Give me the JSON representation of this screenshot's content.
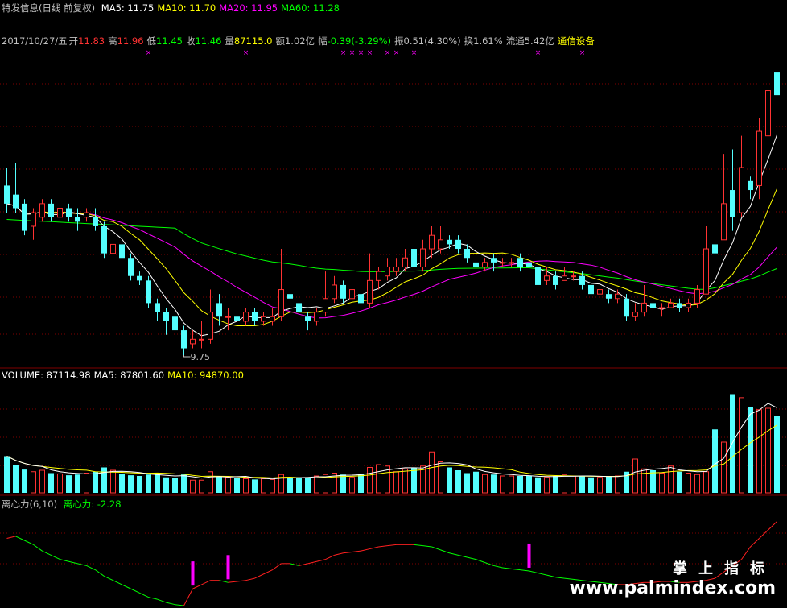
{
  "header": {
    "stock_name": "特发信息(日线 前复权)",
    "ma_items": [
      {
        "label": "MA5: 11.75",
        "color": "#ffffff"
      },
      {
        "label": "MA10: 11.70",
        "color": "#ffff00"
      },
      {
        "label": "MA20: 11.95",
        "color": "#ff00ff"
      },
      {
        "label": "MA60: 11.28",
        "color": "#00ff00"
      }
    ]
  },
  "quote": {
    "date": "2017/10/27/五",
    "open_label": "开",
    "open": "11.83",
    "high_label": "高",
    "high": "11.96",
    "low_label": "低",
    "low": "11.45",
    "close_label": "收",
    "close": "11.46",
    "vol_label": "量",
    "vol": "87115.0",
    "amt_label": "额",
    "amt": "1.02亿",
    "chg_label": "幅",
    "chg": "-0.39(-3.29%)",
    "amp_label": "振",
    "amp": "0.51(4.30%)",
    "turn_label": "换",
    "turn": "1.61%",
    "float_label": "流通",
    "float": "5.42亿",
    "industry": "通信设备"
  },
  "volume_header": {
    "items": [
      {
        "label": "VOLUME: 87114.98",
        "color": "#ffffff"
      },
      {
        "label": "MA5: 87801.60",
        "color": "#ffffff"
      },
      {
        "label": "MA10: 94870.00",
        "color": "#ffff00"
      }
    ]
  },
  "indicator_header": {
    "name": "离心力(6,10)",
    "value_label": "离心力: -2.28"
  },
  "low_marker": "9.75",
  "watermark": {
    "cn": "掌上指标",
    "en": "www.palmindex.com"
  },
  "colors": {
    "up": "#ff3232",
    "down": "#54ffff",
    "ma5": "#ffffff",
    "ma10": "#ffff00",
    "ma20": "#ff00ff",
    "ma60": "#00ff00",
    "grid": "#800000"
  },
  "chart_data": {
    "type": "candlestick",
    "price_axis_range": [
      9.5,
      16.5
    ],
    "candles": [
      [
        13.5,
        13.1,
        13.9,
        12.9
      ],
      [
        13.3,
        13.0,
        14.0,
        12.9
      ],
      [
        13.1,
        12.5,
        13.2,
        12.4
      ],
      [
        12.6,
        12.9,
        13.0,
        12.3
      ],
      [
        12.8,
        13.1,
        13.2,
        12.7
      ],
      [
        13.1,
        12.8,
        13.2,
        12.7
      ],
      [
        12.8,
        13.0,
        13.1,
        12.7
      ],
      [
        13.0,
        12.8,
        13.1,
        12.7
      ],
      [
        12.8,
        12.7,
        13.0,
        12.5
      ],
      [
        12.8,
        12.9,
        13.0,
        12.7
      ],
      [
        12.8,
        12.6,
        13.0,
        12.5
      ],
      [
        12.6,
        12.0,
        12.7,
        11.9
      ],
      [
        12.0,
        12.2,
        12.3,
        11.9
      ],
      [
        12.2,
        11.9,
        12.3,
        11.8
      ],
      [
        11.9,
        11.5,
        12.0,
        11.4
      ],
      [
        11.5,
        11.4,
        11.6,
        11.3
      ],
      [
        11.4,
        10.9,
        11.5,
        10.8
      ],
      [
        10.9,
        10.7,
        11.0,
        10.5
      ],
      [
        10.7,
        10.5,
        10.8,
        10.2
      ],
      [
        10.6,
        10.3,
        10.7,
        10.1
      ],
      [
        10.3,
        9.9,
        10.4,
        9.75
      ],
      [
        10.0,
        10.1,
        10.3,
        9.9
      ],
      [
        10.1,
        10.1,
        10.5,
        9.9
      ],
      [
        10.1,
        10.7,
        11.2,
        10.0
      ],
      [
        10.9,
        10.6,
        11.1,
        10.4
      ],
      [
        10.6,
        10.6,
        10.8,
        10.3
      ],
      [
        10.6,
        10.5,
        10.7,
        10.3
      ],
      [
        10.5,
        10.7,
        10.8,
        10.4
      ],
      [
        10.7,
        10.5,
        10.8,
        10.4
      ],
      [
        10.5,
        10.6,
        10.7,
        10.4
      ],
      [
        10.5,
        10.6,
        10.8,
        10.4
      ],
      [
        10.6,
        11.2,
        12.1,
        10.5
      ],
      [
        11.1,
        11.0,
        11.3,
        10.9
      ],
      [
        10.9,
        10.7,
        11.0,
        10.6
      ],
      [
        10.6,
        10.5,
        10.7,
        10.3
      ],
      [
        10.5,
        10.7,
        10.8,
        10.4
      ],
      [
        10.7,
        11.0,
        11.6,
        10.6
      ],
      [
        11.0,
        11.3,
        11.5,
        10.9
      ],
      [
        11.3,
        11.0,
        11.4,
        10.9
      ],
      [
        11.0,
        11.2,
        11.4,
        10.9
      ],
      [
        11.1,
        10.9,
        11.2,
        10.8
      ],
      [
        10.9,
        11.4,
        12.0,
        10.8
      ],
      [
        11.4,
        11.6,
        11.7,
        11.2
      ],
      [
        11.5,
        11.7,
        11.9,
        11.4
      ],
      [
        11.6,
        11.7,
        11.9,
        11.5
      ],
      [
        11.7,
        11.9,
        12.1,
        11.6
      ],
      [
        12.1,
        11.7,
        12.2,
        11.6
      ],
      [
        11.7,
        12.1,
        12.3,
        11.6
      ],
      [
        12.1,
        12.4,
        12.6,
        11.9
      ],
      [
        12.1,
        12.3,
        12.6,
        12.0
      ],
      [
        12.3,
        12.2,
        12.4,
        12.1
      ],
      [
        12.3,
        12.1,
        12.4,
        12.0
      ],
      [
        12.1,
        11.9,
        12.2,
        11.8
      ],
      [
        11.8,
        11.7,
        12.0,
        11.6
      ],
      [
        11.7,
        11.8,
        11.9,
        11.6
      ],
      [
        11.9,
        11.8,
        12.0,
        11.6
      ],
      [
        11.8,
        11.8,
        11.9,
        11.7
      ],
      [
        11.8,
        11.8,
        11.9,
        11.7
      ],
      [
        11.9,
        11.7,
        12.0,
        11.6
      ],
      [
        11.8,
        11.7,
        11.9,
        11.6
      ],
      [
        11.7,
        11.3,
        11.8,
        11.2
      ],
      [
        11.4,
        11.5,
        11.7,
        11.3
      ],
      [
        11.5,
        11.3,
        11.6,
        11.2
      ],
      [
        11.4,
        11.5,
        11.7,
        11.4
      ],
      [
        11.5,
        11.5,
        11.6,
        11.4
      ],
      [
        11.5,
        11.3,
        11.6,
        11.2
      ],
      [
        11.3,
        11.1,
        11.4,
        11.0
      ],
      [
        11.1,
        11.2,
        11.3,
        11.0
      ],
      [
        11.1,
        11.0,
        11.2,
        10.9
      ],
      [
        11.0,
        11.1,
        11.2,
        10.9
      ],
      [
        11.0,
        10.6,
        11.1,
        10.5
      ],
      [
        10.6,
        10.7,
        10.9,
        10.5
      ],
      [
        10.7,
        10.9,
        11.3,
        10.6
      ],
      [
        10.9,
        10.8,
        11.0,
        10.6
      ],
      [
        10.8,
        10.8,
        10.9,
        10.6
      ],
      [
        10.8,
        10.9,
        11.0,
        10.8
      ],
      [
        10.9,
        10.8,
        11.0,
        10.7
      ],
      [
        10.8,
        10.9,
        11.0,
        10.7
      ],
      [
        10.9,
        11.2,
        11.3,
        10.8
      ],
      [
        11.1,
        12.1,
        12.6,
        11.1
      ],
      [
        12.2,
        12.0,
        13.6,
        11.9
      ],
      [
        12.3,
        13.1,
        14.2,
        12.3
      ],
      [
        13.4,
        12.8,
        14.3,
        12.5
      ],
      [
        12.9,
        13.9,
        14.6,
        12.8
      ],
      [
        13.6,
        13.4,
        13.7,
        13.2
      ],
      [
        13.5,
        14.7,
        15.0,
        13.2
      ],
      [
        14.6,
        15.6,
        16.4,
        14.5
      ],
      [
        16.0,
        15.5,
        16.5,
        14.6
      ]
    ],
    "volume_axis_range": [
      0,
      160000
    ],
    "volume": [
      52000,
      40000,
      33000,
      30000,
      32000,
      28000,
      27000,
      25000,
      26000,
      28000,
      30000,
      36000,
      32000,
      27000,
      25000,
      24000,
      26000,
      27000,
      22000,
      21000,
      26000,
      18000,
      18000,
      30000,
      24000,
      22000,
      21000,
      20000,
      19000,
      20000,
      19000,
      26000,
      22000,
      21000,
      21000,
      24000,
      26000,
      28000,
      26000,
      22000,
      27000,
      36000,
      40000,
      38000,
      30000,
      34000,
      36000,
      38000,
      58000,
      44000,
      36000,
      32000,
      28000,
      30000,
      26000,
      26000,
      24000,
      24000,
      24000,
      24000,
      22000,
      22000,
      24000,
      26000,
      24000,
      24000,
      22000,
      22000,
      24000,
      24000,
      30000,
      48000,
      34000,
      32000,
      28000,
      38000,
      30000,
      28000,
      26000,
      30000,
      90000,
      72000,
      140000,
      135000,
      122000,
      118000,
      120000,
      109000
    ],
    "indicator_name": "离心力",
    "indicator_value": -2.28,
    "indicator_axis_range": [
      -3.4,
      1.2
    ],
    "indicator": [
      -0.2,
      -0.1,
      -0.3,
      -0.5,
      -0.8,
      -1.0,
      -1.2,
      -1.3,
      -1.4,
      -1.5,
      -1.7,
      -2.0,
      -2.2,
      -2.4,
      -2.6,
      -2.8,
      -3.0,
      -3.1,
      -3.25,
      -3.35,
      -3.4,
      -2.6,
      -2.4,
      -2.2,
      -2.2,
      -2.3,
      -2.25,
      -2.2,
      -2.1,
      -1.9,
      -1.7,
      -1.4,
      -1.4,
      -1.5,
      -1.4,
      -1.3,
      -1.2,
      -1.0,
      -0.9,
      -0.85,
      -0.8,
      -0.7,
      -0.6,
      -0.55,
      -0.5,
      -0.5,
      -0.5,
      -0.55,
      -0.6,
      -0.75,
      -0.9,
      -1.0,
      -1.1,
      -1.2,
      -1.35,
      -1.5,
      -1.6,
      -1.65,
      -1.7,
      -1.75,
      -1.85,
      -1.95,
      -2.05,
      -2.1,
      -2.15,
      -2.2,
      -2.25,
      -2.3,
      -2.35,
      -2.4,
      -2.4,
      -2.35,
      -2.3,
      -2.3,
      -2.25,
      -2.25,
      -2.3,
      -2.3,
      -2.25,
      -2.2,
      -2.1,
      -1.8,
      -1.5,
      -1.2,
      -0.6,
      -0.2,
      0.2,
      0.6
    ],
    "signals": [
      21,
      25,
      59
    ],
    "marker_days": [
      16,
      27,
      38,
      39,
      40,
      41,
      43,
      44,
      46,
      60,
      65
    ],
    "low_marker_day": 20
  }
}
